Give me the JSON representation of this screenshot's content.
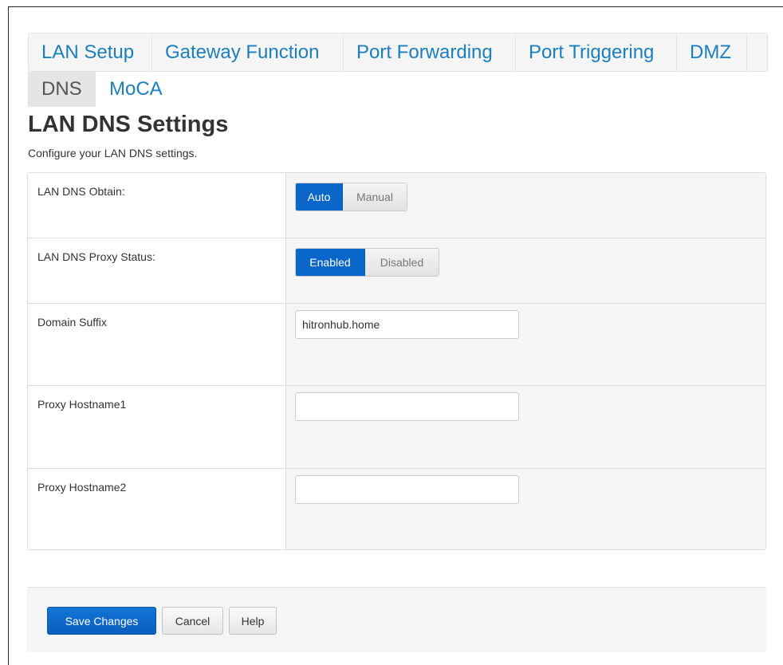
{
  "tabs": {
    "row1": [
      "LAN Setup",
      "Gateway Function",
      "Port Forwarding",
      "Port Triggering",
      "DMZ"
    ],
    "row2": [
      "DNS",
      "MoCA"
    ],
    "active": "DNS"
  },
  "page": {
    "title": "LAN DNS Settings",
    "description": "Configure your LAN DNS settings."
  },
  "settings": {
    "dns_obtain": {
      "label": "LAN DNS Obtain:",
      "options": [
        "Auto",
        "Manual"
      ],
      "selected": "Auto"
    },
    "proxy_status": {
      "label": "LAN DNS Proxy Status:",
      "options": [
        "Enabled",
        "Disabled"
      ],
      "selected": "Enabled"
    },
    "domain_suffix": {
      "label": "Domain Suffix",
      "value": "hitronhub.home"
    },
    "proxy_hostname1": {
      "label": "Proxy Hostname1",
      "value": ""
    },
    "proxy_hostname2": {
      "label": "Proxy Hostname2",
      "value": ""
    }
  },
  "footer": {
    "save_label": "Save Changes",
    "cancel_label": "Cancel",
    "help_label": "Help"
  },
  "colors": {
    "link": "#1a7fc1",
    "primary": "#0a66c9",
    "panel_bg": "#f5f5f5"
  }
}
